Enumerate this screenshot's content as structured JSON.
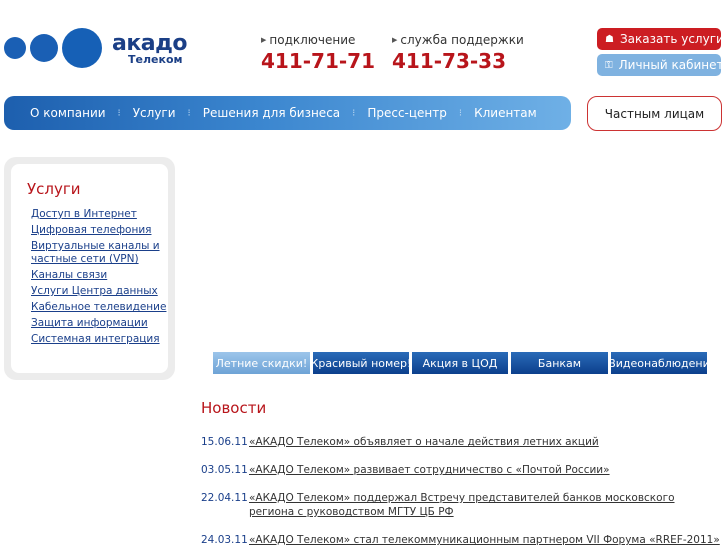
{
  "logo": {
    "brand": "акадо",
    "sub": "Телеком"
  },
  "phones": [
    {
      "caption": "подключение",
      "number": "411-71-71"
    },
    {
      "caption": "служба поддержки",
      "number": "411-73-33"
    }
  ],
  "top_buttons": {
    "order": "Заказать услуги",
    "cabinet": "Личный кабинет"
  },
  "nav": {
    "items": [
      "О компании",
      "Услуги",
      "Решения для бизнеса",
      "Пресс-центр",
      "Клиентам"
    ],
    "private": "Частным лицам"
  },
  "sidebar": {
    "title": "Услуги",
    "links": [
      "Доступ в Интернет",
      "Цифровая телефония",
      "Виртуальные каналы и частные сети (VPN)",
      "Каналы связи",
      "Услуги Центра данных",
      "Кабельное телевидение",
      "Защита информации",
      "Системная интеграция"
    ]
  },
  "tabs": [
    "Летние скидки!",
    "Красивый номер!",
    "Акция в ЦОД",
    "Банкам",
    "Видеонаблюдени"
  ],
  "news": {
    "title": "Новости",
    "items": [
      {
        "date": "15.06.11",
        "text": "«АКАДО Телеком» объявляет о начале действия летних акций"
      },
      {
        "date": "03.05.11",
        "text": "«АКАДО Телеком» развивает сотрудничество с «Почтой России»"
      },
      {
        "date": "22.04.11",
        "text": "«АКАДО Телеком» поддержал Встречу представителей банков московского региона с руководством МГТУ ЦБ РФ"
      },
      {
        "date": "24.03.11",
        "text": "«АКАДО Телеком» стал телекоммуникационным партнером VII Форума «RREF-2011»"
      }
    ]
  },
  "colors": {
    "accent_red": "#b8151b",
    "brand_blue": "#1a5fb4",
    "link_blue": "#1a3f8a"
  }
}
